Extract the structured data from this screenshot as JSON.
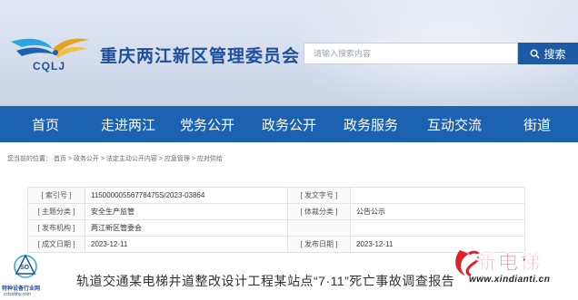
{
  "header": {
    "logo_text": "CQLJ",
    "site_title": "重庆两江新区管理委员会"
  },
  "search": {
    "placeholder": "请输入搜索内容",
    "button_label": "搜索"
  },
  "nav": {
    "items": [
      {
        "label": "首页"
      },
      {
        "label": "走进两江"
      },
      {
        "label": "党务公开"
      },
      {
        "label": "政务公开"
      },
      {
        "label": "政务服务"
      },
      {
        "label": "互动交流"
      },
      {
        "label": "街道"
      }
    ]
  },
  "breadcrumb": "您当前的位置： 首页 > 政务公开 > 法定主动公开内容 > 应急管理 > 应对供给",
  "info_table": {
    "rows": [
      {
        "label1": "[ 索引号 ]",
        "value1": "11500000556778475S/2023-03864",
        "label2": "[ 发文字号 ]",
        "value2": ""
      },
      {
        "label1": "[ 主题分类 ]",
        "value1": "安全生产监管",
        "label2": "[ 体裁分类 ]",
        "value2": "公告公示"
      },
      {
        "label1": "[ 发布机构 ]",
        "value1": "两江新区管委会",
        "label2": "",
        "value2": ""
      },
      {
        "label1": "[ 成文日期 ]",
        "value1": "2023-12-11",
        "label2": "[ 发布日期 ]",
        "value2": "2023-12-11"
      }
    ]
  },
  "article_title": "轨道交通某电梯井道整改设计工程某站点“7·11”死亡事故调查报告",
  "watermark_left": {
    "text": "特种设备行业网",
    "url": "cctzsbhy.com"
  },
  "watermark_right": {
    "name": "新电梯",
    "url": "www.xindianti.cn"
  },
  "colors": {
    "nav_bg": "#1c62b0",
    "title_blue": "#1d4f9c",
    "search_button": "#1c5aa8",
    "watermark_red": "#d8232a"
  }
}
